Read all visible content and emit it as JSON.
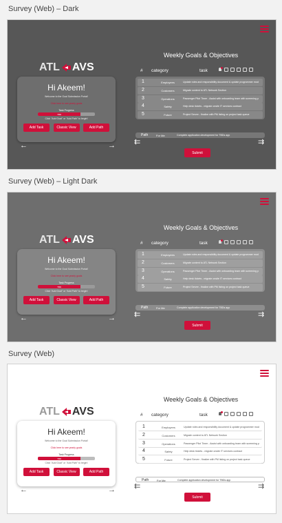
{
  "sections": [
    {
      "label": "Survey (Web) – Dark"
    },
    {
      "label": "Survey (Web) – Light Dark"
    },
    {
      "label": "Survey (Web)"
    }
  ],
  "logo": {
    "left": "ATL",
    "right": "AVS"
  },
  "card": {
    "greeting": "Hi Akeem!",
    "welcome": "Welcome to the Goal Submission Portal!",
    "yearly_link": "Click here to see yearly goals",
    "progress_label": "Task Progress",
    "progress_value": "TBD",
    "progress_fraction": 0.75,
    "hint": "Click \"Add Goal\" or \"Add Path\" to begin!",
    "buttons": {
      "add_task": "Add Task",
      "classic_view": "Classic View",
      "add_path": "Add Path"
    }
  },
  "table": {
    "title": "Weekly Goals & Objectives",
    "headers": {
      "number": "#",
      "category": "category",
      "task": "task"
    },
    "rows": [
      {
        "n": "1",
        "category": "Employees",
        "task": "Update roles and responsibility document & update programmer model documentation"
      },
      {
        "n": "2",
        "category": "Customers",
        "task": "Migrate content to ATL Network Section"
      },
      {
        "n": "3",
        "category": "Operations",
        "task": "Passenger Pilot Timer - Assist with onboarding team with screening procedures"
      },
      {
        "n": "4",
        "category": "Safety",
        "task": "Help desk tickets - migrate onsite IT services contract"
      },
      {
        "n": "5",
        "category": "Future",
        "task": "Project Server - finalize with PM listing on project task queue"
      }
    ],
    "path": {
      "label": "Path",
      "for": "For Me",
      "desc": "Complete application development for TBDs app"
    },
    "submit": "Submit"
  },
  "colors": {
    "accent": "#d0103a",
    "dark_bg": "#575757",
    "light_dark_bg": "#6e6e6e",
    "light_bg": "#ffffff"
  }
}
